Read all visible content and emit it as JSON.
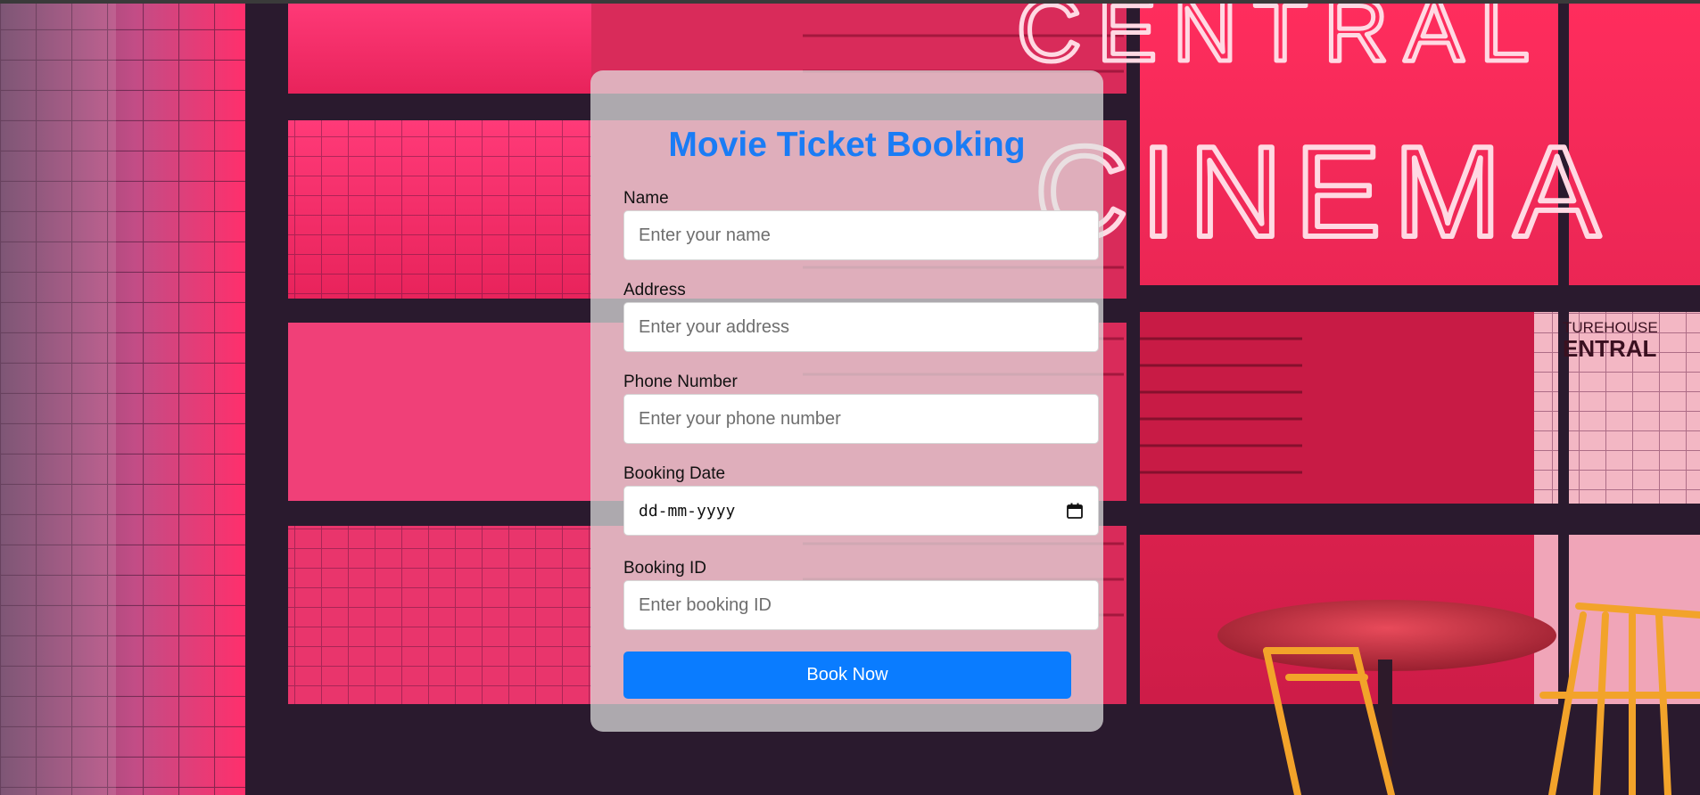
{
  "form": {
    "title": "Movie Ticket Booking",
    "fields": [
      {
        "label": "Name",
        "placeholder": "Enter your name"
      },
      {
        "label": "Address",
        "placeholder": "Enter your address"
      },
      {
        "label": "Phone Number",
        "placeholder": "Enter your phone number"
      },
      {
        "label": "Booking Date",
        "placeholder": "dd-mm-yyyy"
      },
      {
        "label": "Booking ID",
        "placeholder": "Enter booking ID"
      }
    ],
    "submit_label": "Book Now"
  },
  "background": {
    "sign_top": "CENTRAL",
    "sign_main": "CINEMA",
    "sign_side_1": "TUREHOUSE",
    "sign_side_2": "ENTRAL"
  },
  "colors": {
    "accent": "#0a7cff",
    "title": "#1a7cf5",
    "neon": "#ff3060"
  }
}
